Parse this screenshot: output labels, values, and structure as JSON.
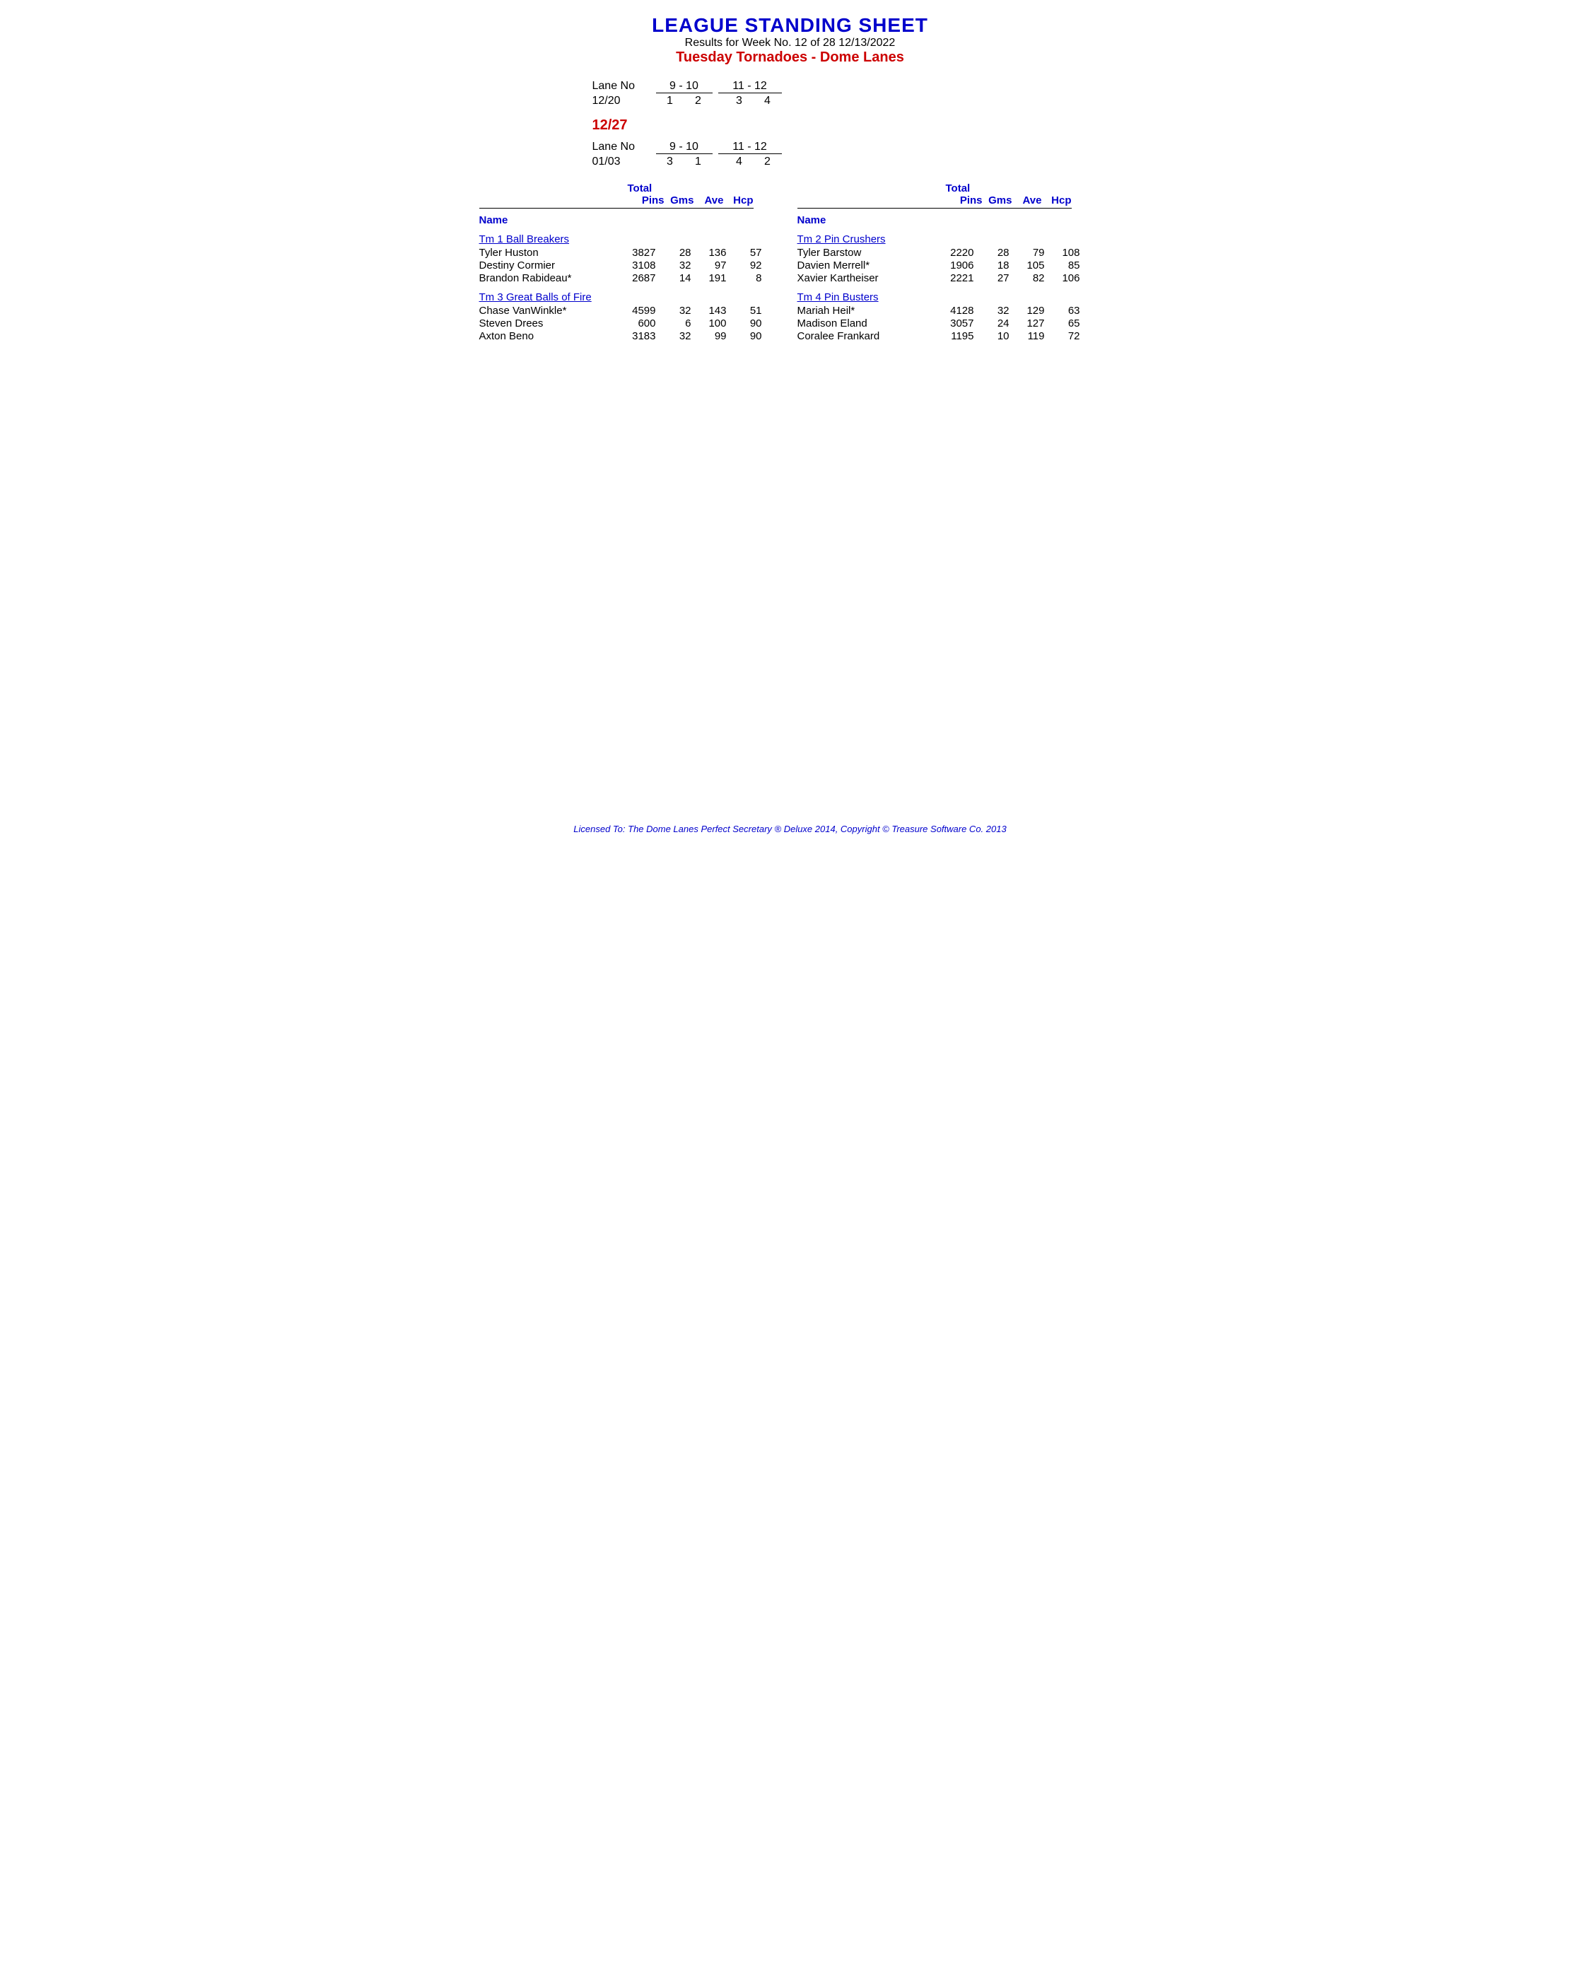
{
  "header": {
    "title": "LEAGUE STANDING SHEET",
    "results_line": "Results for Week No. 12 of 28    12/13/2022",
    "league_name": "Tuesday Tornadoes - Dome Lanes"
  },
  "schedule1": {
    "label": "Lane No",
    "range1": "9 - 10",
    "range2": "11 - 12",
    "date": "12/20",
    "val1": "1",
    "val2": "2",
    "val3": "3",
    "val4": "4"
  },
  "next_date": "12/27",
  "schedule2": {
    "label": "Lane No",
    "range1": "9 - 10",
    "range2": "11 - 12",
    "date": "01/03",
    "val1": "3",
    "val2": "1",
    "val3": "4",
    "val4": "2"
  },
  "columns": {
    "name": "Name",
    "total": "Total",
    "pins": "Pins",
    "gms": "Gms",
    "ave": "Ave",
    "hcp": "Hcp"
  },
  "teams": [
    {
      "id": "tm1",
      "name": "Tm 1 Ball Breakers",
      "players": [
        {
          "name": "Tyler Huston",
          "pins": "3827",
          "gms": "28",
          "ave": "136",
          "hcp": "57"
        },
        {
          "name": "Destiny Cormier",
          "pins": "3108",
          "gms": "32",
          "ave": "97",
          "hcp": "92"
        },
        {
          "name": "Brandon Rabideau*",
          "pins": "2687",
          "gms": "14",
          "ave": "191",
          "hcp": "8"
        }
      ]
    },
    {
      "id": "tm3",
      "name": "Tm 3 Great Balls of Fire",
      "players": [
        {
          "name": "Chase VanWinkle*",
          "pins": "4599",
          "gms": "32",
          "ave": "143",
          "hcp": "51"
        },
        {
          "name": "Steven Drees",
          "pins": "600",
          "gms": "6",
          "ave": "100",
          "hcp": "90"
        },
        {
          "name": "Axton Beno",
          "pins": "3183",
          "gms": "32",
          "ave": "99",
          "hcp": "90"
        }
      ]
    }
  ],
  "teams_right": [
    {
      "id": "tm2",
      "name": "Tm 2 Pin Crushers",
      "players": [
        {
          "name": "Tyler Barstow",
          "pins": "2220",
          "gms": "28",
          "ave": "79",
          "hcp": "108"
        },
        {
          "name": "Davien Merrell*",
          "pins": "1906",
          "gms": "18",
          "ave": "105",
          "hcp": "85"
        },
        {
          "name": "Xavier Kartheiser",
          "pins": "2221",
          "gms": "27",
          "ave": "82",
          "hcp": "106"
        }
      ]
    },
    {
      "id": "tm4",
      "name": "Tm 4 Pin Busters",
      "players": [
        {
          "name": "Mariah Heil*",
          "pins": "4128",
          "gms": "32",
          "ave": "129",
          "hcp": "63"
        },
        {
          "name": "Madison Eland",
          "pins": "3057",
          "gms": "24",
          "ave": "127",
          "hcp": "65"
        },
        {
          "name": "Coralee Frankard",
          "pins": "1195",
          "gms": "10",
          "ave": "119",
          "hcp": "72"
        }
      ]
    }
  ],
  "footer": {
    "text": "Licensed To: The Dome Lanes    Perfect Secretary ® Deluxe  2014, Copyright © Treasure Software Co. 2013"
  }
}
